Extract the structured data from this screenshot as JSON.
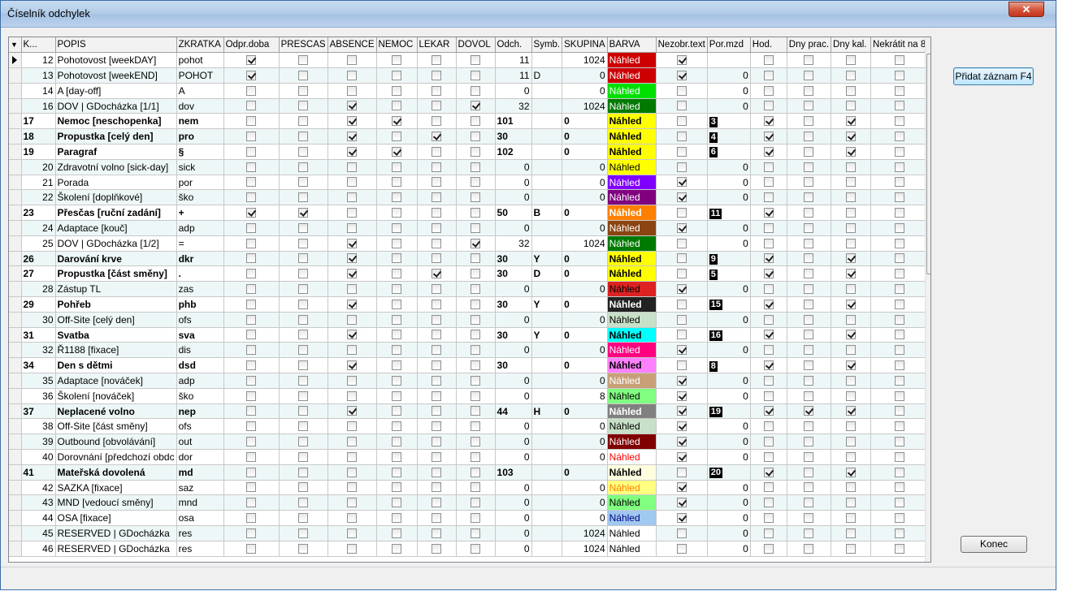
{
  "window": {
    "title": "Číselník odchylek",
    "close_symbol": "✕"
  },
  "buttons": {
    "add": "Přidat záznam F4",
    "close": "Konec"
  },
  "colors": {
    "titlebar": "#b4cde8",
    "row_even": "#eef7f7",
    "row_odd": "#ffffff",
    "close_button": "#c2331c"
  },
  "columns": [
    "K...",
    "POPIS",
    "ZKRATKA",
    "Odpr.doba",
    "PRESCAS",
    "ABSENCE",
    "NEMOC",
    "LEKAR",
    "DOVOL",
    "Odch.",
    "Symb.",
    "SKUPINA",
    "BARVA",
    "Nezobr.text",
    "Por.mzd",
    "Hod.",
    "Dny prac.",
    "Dny kal.",
    "Nekrátit na 8"
  ],
  "rows": [
    {
      "k": "12",
      "popis": "Pohotovost [weekDAY]",
      "zkratka": "pohot",
      "odpr": 1,
      "prescas": 0,
      "absence": 0,
      "nemoc": 0,
      "lekar": 0,
      "dovol": 0,
      "odch": "11",
      "symb": "",
      "skupina": "1024",
      "barva_text": "Náhled",
      "barva_bg": "#cc0000",
      "barva_fg": "#ffffff",
      "nezobr": 1,
      "pormzd": "",
      "hod": 0,
      "dnyprac": 0,
      "dnykal": 0,
      "nekratit": 0,
      "bold": false
    },
    {
      "k": "13",
      "popis": "Pohotovost [weekEND]",
      "zkratka": "POHOT",
      "odpr": 1,
      "prescas": 0,
      "absence": 0,
      "nemoc": 0,
      "lekar": 0,
      "dovol": 0,
      "odch": "11",
      "symb": "D",
      "skupina": "0",
      "barva_text": "Náhled",
      "barva_bg": "#cc0000",
      "barva_fg": "#ffffff",
      "nezobr": 1,
      "pormzd": "0",
      "hod": 0,
      "dnyprac": 0,
      "dnykal": 0,
      "nekratit": 0,
      "bold": false
    },
    {
      "k": "14",
      "popis": "A [day-off]",
      "zkratka": "A",
      "odpr": 0,
      "prescas": 0,
      "absence": 0,
      "nemoc": 0,
      "lekar": 0,
      "dovol": 0,
      "odch": "0",
      "symb": "",
      "skupina": "0",
      "barva_text": "Náhled",
      "barva_bg": "#00e000",
      "barva_fg": "#ffffff",
      "nezobr": 0,
      "pormzd": "0",
      "hod": 0,
      "dnyprac": 0,
      "dnykal": 0,
      "nekratit": 0,
      "bold": false
    },
    {
      "k": "16",
      "popis": "DOV | GDocházka [1/1]",
      "zkratka": "dov",
      "odpr": 0,
      "prescas": 0,
      "absence": 1,
      "nemoc": 0,
      "lekar": 0,
      "dovol": 1,
      "odch": "32",
      "symb": "",
      "skupina": "1024",
      "barva_text": "Náhled",
      "barva_bg": "#007a00",
      "barva_fg": "#ffffff",
      "nezobr": 0,
      "pormzd": "0",
      "hod": 0,
      "dnyprac": 0,
      "dnykal": 0,
      "nekratit": 0,
      "bold": false
    },
    {
      "k": "17",
      "popis": "Nemoc [neschopenka]",
      "zkratka": "nem",
      "odpr": 0,
      "prescas": 0,
      "absence": 1,
      "nemoc": 1,
      "lekar": 0,
      "dovol": 0,
      "odch": "101",
      "symb": "",
      "skupina": "0",
      "barva_text": "Náhled",
      "barva_bg": "#ffff00",
      "barva_fg": "#000000",
      "nezobr": 0,
      "pormzd": "3",
      "hod": 1,
      "dnyprac": 0,
      "dnykal": 1,
      "nekratit": 0,
      "bold": true
    },
    {
      "k": "18",
      "popis": "Propustka [celý den]",
      "zkratka": "pro",
      "odpr": 0,
      "prescas": 0,
      "absence": 1,
      "nemoc": 0,
      "lekar": 1,
      "dovol": 0,
      "odch": "30",
      "symb": "",
      "skupina": "0",
      "barva_text": "Náhled",
      "barva_bg": "#ffff00",
      "barva_fg": "#000000",
      "nezobr": 0,
      "pormzd": "4",
      "hod": 1,
      "dnyprac": 0,
      "dnykal": 1,
      "nekratit": 0,
      "bold": true
    },
    {
      "k": "19",
      "popis": "Paragraf",
      "zkratka": "§",
      "odpr": 0,
      "prescas": 0,
      "absence": 1,
      "nemoc": 1,
      "lekar": 0,
      "dovol": 0,
      "odch": "102",
      "symb": "",
      "skupina": "0",
      "barva_text": "Náhled",
      "barva_bg": "#ffff00",
      "barva_fg": "#000000",
      "nezobr": 0,
      "pormzd": "6",
      "hod": 1,
      "dnyprac": 0,
      "dnykal": 1,
      "nekratit": 0,
      "bold": true
    },
    {
      "k": "20",
      "popis": "Zdravotní volno [sick-day]",
      "zkratka": "sick",
      "odpr": 0,
      "prescas": 0,
      "absence": 0,
      "nemoc": 0,
      "lekar": 0,
      "dovol": 0,
      "odch": "0",
      "symb": "",
      "skupina": "0",
      "barva_text": "Náhled",
      "barva_bg": "#ffff00",
      "barva_fg": "#000000",
      "nezobr": 0,
      "pormzd": "0",
      "hod": 0,
      "dnyprac": 0,
      "dnykal": 0,
      "nekratit": 0,
      "bold": false
    },
    {
      "k": "21",
      "popis": "Porada",
      "zkratka": "por",
      "odpr": 0,
      "prescas": 0,
      "absence": 0,
      "nemoc": 0,
      "lekar": 0,
      "dovol": 0,
      "odch": "0",
      "symb": "",
      "skupina": "0",
      "barva_text": "Náhled",
      "barva_bg": "#8000ff",
      "barva_fg": "#ffffff",
      "nezobr": 1,
      "pormzd": "0",
      "hod": 0,
      "dnyprac": 0,
      "dnykal": 0,
      "nekratit": 0,
      "bold": false
    },
    {
      "k": "22",
      "popis": "Školení [doplňkové]",
      "zkratka": "ško",
      "odpr": 0,
      "prescas": 0,
      "absence": 0,
      "nemoc": 0,
      "lekar": 0,
      "dovol": 0,
      "odch": "0",
      "symb": "",
      "skupina": "0",
      "barva_text": "Náhled",
      "barva_bg": "#800080",
      "barva_fg": "#ffffff",
      "nezobr": 1,
      "pormzd": "0",
      "hod": 0,
      "dnyprac": 0,
      "dnykal": 0,
      "nekratit": 0,
      "bold": false
    },
    {
      "k": "23",
      "popis": "Přesčas [ruční zadání]",
      "zkratka": "+",
      "odpr": 1,
      "prescas": 1,
      "absence": 0,
      "nemoc": 0,
      "lekar": 0,
      "dovol": 0,
      "odch": "50",
      "symb": "B",
      "skupina": "0",
      "barva_text": "Náhled",
      "barva_bg": "#ff8000",
      "barva_fg": "#ffffff",
      "nezobr": 0,
      "pormzd": "11",
      "hod": 1,
      "dnyprac": 0,
      "dnykal": 0,
      "nekratit": 0,
      "bold": true
    },
    {
      "k": "24",
      "popis": "Adaptace [kouč]",
      "zkratka": "adp",
      "odpr": 0,
      "prescas": 0,
      "absence": 0,
      "nemoc": 0,
      "lekar": 0,
      "dovol": 0,
      "odch": "0",
      "symb": "",
      "skupina": "0",
      "barva_text": "Náhled",
      "barva_bg": "#8b4513",
      "barva_fg": "#ffffff",
      "nezobr": 1,
      "pormzd": "0",
      "hod": 0,
      "dnyprac": 0,
      "dnykal": 0,
      "nekratit": 0,
      "bold": false
    },
    {
      "k": "25",
      "popis": "DOV | GDocházka [1/2]",
      "zkratka": "=",
      "odpr": 0,
      "prescas": 0,
      "absence": 1,
      "nemoc": 0,
      "lekar": 0,
      "dovol": 1,
      "odch": "32",
      "symb": "",
      "skupina": "1024",
      "barva_text": "Náhled",
      "barva_bg": "#007a00",
      "barva_fg": "#ffffff",
      "nezobr": 0,
      "pormzd": "0",
      "hod": 0,
      "dnyprac": 0,
      "dnykal": 0,
      "nekratit": 0,
      "bold": false
    },
    {
      "k": "26",
      "popis": "Darování krve",
      "zkratka": "dkr",
      "odpr": 0,
      "prescas": 0,
      "absence": 1,
      "nemoc": 0,
      "lekar": 0,
      "dovol": 0,
      "odch": "30",
      "symb": "Y",
      "skupina": "0",
      "barva_text": "Náhled",
      "barva_bg": "#ffff00",
      "barva_fg": "#000000",
      "nezobr": 0,
      "pormzd": "9",
      "hod": 1,
      "dnyprac": 0,
      "dnykal": 1,
      "nekratit": 0,
      "bold": true
    },
    {
      "k": "27",
      "popis": "Propustka [část směny]",
      "zkratka": ".",
      "odpr": 0,
      "prescas": 0,
      "absence": 1,
      "nemoc": 0,
      "lekar": 1,
      "dovol": 0,
      "odch": "30",
      "symb": "D",
      "skupina": "0",
      "barva_text": "Náhled",
      "barva_bg": "#ffff00",
      "barva_fg": "#000000",
      "nezobr": 0,
      "pormzd": "5",
      "hod": 1,
      "dnyprac": 0,
      "dnykal": 1,
      "nekratit": 0,
      "bold": true
    },
    {
      "k": "28",
      "popis": "Zástup TL",
      "zkratka": "zas",
      "odpr": 0,
      "prescas": 0,
      "absence": 0,
      "nemoc": 0,
      "lekar": 0,
      "dovol": 0,
      "odch": "0",
      "symb": "",
      "skupina": "0",
      "barva_text": "Náhled",
      "barva_bg": "#dd2222",
      "barva_fg": "#000000",
      "nezobr": 1,
      "pormzd": "0",
      "hod": 0,
      "dnyprac": 0,
      "dnykal": 0,
      "nekratit": 0,
      "bold": false
    },
    {
      "k": "29",
      "popis": "Pohřeb",
      "zkratka": "phb",
      "odpr": 0,
      "prescas": 0,
      "absence": 1,
      "nemoc": 0,
      "lekar": 0,
      "dovol": 0,
      "odch": "30",
      "symb": "Y",
      "skupina": "0",
      "barva_text": "Náhled",
      "barva_bg": "#222222",
      "barva_fg": "#ffffff",
      "nezobr": 0,
      "pormzd": "15",
      "hod": 1,
      "dnyprac": 0,
      "dnykal": 1,
      "nekratit": 0,
      "bold": true
    },
    {
      "k": "30",
      "popis": "Off-Site [celý den]",
      "zkratka": "ofs",
      "odpr": 0,
      "prescas": 0,
      "absence": 0,
      "nemoc": 0,
      "lekar": 0,
      "dovol": 0,
      "odch": "0",
      "symb": "",
      "skupina": "0",
      "barva_text": "Náhled",
      "barva_bg": "#c8e0c8",
      "barva_fg": "#000000",
      "nezobr": 0,
      "pormzd": "0",
      "hod": 0,
      "dnyprac": 0,
      "dnykal": 0,
      "nekratit": 0,
      "bold": false
    },
    {
      "k": "31",
      "popis": "Svatba",
      "zkratka": "sva",
      "odpr": 0,
      "prescas": 0,
      "absence": 1,
      "nemoc": 0,
      "lekar": 0,
      "dovol": 0,
      "odch": "30",
      "symb": "Y",
      "skupina": "0",
      "barva_text": "Náhled",
      "barva_bg": "#00ffff",
      "barva_fg": "#000000",
      "nezobr": 0,
      "pormzd": "16",
      "hod": 1,
      "dnyprac": 0,
      "dnykal": 1,
      "nekratit": 0,
      "bold": true
    },
    {
      "k": "32",
      "popis": "Ř1188 [fixace]",
      "zkratka": "dis",
      "odpr": 0,
      "prescas": 0,
      "absence": 0,
      "nemoc": 0,
      "lekar": 0,
      "dovol": 0,
      "odch": "0",
      "symb": "",
      "skupina": "0",
      "barva_text": "Náhled",
      "barva_bg": "#ff0080",
      "barva_fg": "#ffffff",
      "nezobr": 1,
      "pormzd": "0",
      "hod": 0,
      "dnyprac": 0,
      "dnykal": 0,
      "nekratit": 0,
      "bold": false
    },
    {
      "k": "34",
      "popis": "Den s dětmi",
      "zkratka": "dsd",
      "odpr": 0,
      "prescas": 0,
      "absence": 1,
      "nemoc": 0,
      "lekar": 0,
      "dovol": 0,
      "odch": "30",
      "symb": "",
      "skupina": "0",
      "barva_text": "Náhled",
      "barva_bg": "#ff80ff",
      "barva_fg": "#000000",
      "nezobr": 0,
      "pormzd": "8",
      "hod": 1,
      "dnyprac": 0,
      "dnykal": 1,
      "nekratit": 0,
      "bold": true
    },
    {
      "k": "35",
      "popis": "Adaptace [nováček]",
      "zkratka": "adp",
      "odpr": 0,
      "prescas": 0,
      "absence": 0,
      "nemoc": 0,
      "lekar": 0,
      "dovol": 0,
      "odch": "0",
      "symb": "",
      "skupina": "0",
      "barva_text": "Náhled",
      "barva_bg": "#c8a078",
      "barva_fg": "#ffffff",
      "nezobr": 1,
      "pormzd": "0",
      "hod": 0,
      "dnyprac": 0,
      "dnykal": 0,
      "nekratit": 0,
      "bold": false
    },
    {
      "k": "36",
      "popis": "Školení [nováček]",
      "zkratka": "ško",
      "odpr": 0,
      "prescas": 0,
      "absence": 0,
      "nemoc": 0,
      "lekar": 0,
      "dovol": 0,
      "odch": "0",
      "symb": "",
      "skupina": "8",
      "barva_text": "Náhled",
      "barva_bg": "#80ff80",
      "barva_fg": "#000000",
      "nezobr": 1,
      "pormzd": "0",
      "hod": 0,
      "dnyprac": 0,
      "dnykal": 0,
      "nekratit": 0,
      "bold": false
    },
    {
      "k": "37",
      "popis": "Neplacené volno",
      "zkratka": "nep",
      "odpr": 0,
      "prescas": 0,
      "absence": 1,
      "nemoc": 0,
      "lekar": 0,
      "dovol": 0,
      "odch": "44",
      "symb": "H",
      "skupina": "0",
      "barva_text": "Náhled",
      "barva_bg": "#808080",
      "barva_fg": "#ffffff",
      "nezobr": 1,
      "pormzd": "19",
      "hod": 1,
      "dnyprac": 1,
      "dnykal": 1,
      "nekratit": 0,
      "bold": true
    },
    {
      "k": "38",
      "popis": "Off-Site [část směny]",
      "zkratka": "ofs",
      "odpr": 0,
      "prescas": 0,
      "absence": 0,
      "nemoc": 0,
      "lekar": 0,
      "dovol": 0,
      "odch": "0",
      "symb": "",
      "skupina": "0",
      "barva_text": "Náhled",
      "barva_bg": "#c8e0c8",
      "barva_fg": "#000000",
      "nezobr": 1,
      "pormzd": "0",
      "hod": 0,
      "dnyprac": 0,
      "dnykal": 0,
      "nekratit": 0,
      "bold": false
    },
    {
      "k": "39",
      "popis": "Outbound [obvolávání]",
      "zkratka": "out",
      "odpr": 0,
      "prescas": 0,
      "absence": 0,
      "nemoc": 0,
      "lekar": 0,
      "dovol": 0,
      "odch": "0",
      "symb": "",
      "skupina": "0",
      "barva_text": "Náhled",
      "barva_bg": "#800000",
      "barva_fg": "#ffffff",
      "nezobr": 1,
      "pormzd": "0",
      "hod": 0,
      "dnyprac": 0,
      "dnykal": 0,
      "nekratit": 0,
      "bold": false
    },
    {
      "k": "40",
      "popis": "Dorovnání [předchozí obdc",
      "zkratka": "dor",
      "odpr": 0,
      "prescas": 0,
      "absence": 0,
      "nemoc": 0,
      "lekar": 0,
      "dovol": 0,
      "odch": "0",
      "symb": "",
      "skupina": "0",
      "barva_text": "Náhled",
      "barva_bg": "#ffffff",
      "barva_fg": "#ff0000",
      "nezobr": 1,
      "pormzd": "0",
      "hod": 0,
      "dnyprac": 0,
      "dnykal": 0,
      "nekratit": 0,
      "bold": false
    },
    {
      "k": "41",
      "popis": "Mateřská dovolená",
      "zkratka": "md",
      "odpr": 0,
      "prescas": 0,
      "absence": 0,
      "nemoc": 0,
      "lekar": 0,
      "dovol": 0,
      "odch": "103",
      "symb": "",
      "skupina": "0",
      "barva_text": "Náhled",
      "barva_bg": "#ffffe0",
      "barva_fg": "#000000",
      "nezobr": 0,
      "pormzd": "20",
      "hod": 1,
      "dnyprac": 0,
      "dnykal": 1,
      "nekratit": 0,
      "bold": true
    },
    {
      "k": "42",
      "popis": "SAZKA [fixace]",
      "zkratka": "saz",
      "odpr": 0,
      "prescas": 0,
      "absence": 0,
      "nemoc": 0,
      "lekar": 0,
      "dovol": 0,
      "odch": "0",
      "symb": "",
      "skupina": "0",
      "barva_text": "Náhled",
      "barva_bg": "#ffff80",
      "barva_fg": "#ff8000",
      "nezobr": 1,
      "pormzd": "0",
      "hod": 0,
      "dnyprac": 0,
      "dnykal": 0,
      "nekratit": 0,
      "bold": false
    },
    {
      "k": "43",
      "popis": "MND [vedoucí směny]",
      "zkratka": "mnd",
      "odpr": 0,
      "prescas": 0,
      "absence": 0,
      "nemoc": 0,
      "lekar": 0,
      "dovol": 0,
      "odch": "0",
      "symb": "",
      "skupina": "0",
      "barva_text": "Náhled",
      "barva_bg": "#80ff80",
      "barva_fg": "#000000",
      "nezobr": 1,
      "pormzd": "0",
      "hod": 0,
      "dnyprac": 0,
      "dnykal": 0,
      "nekratit": 0,
      "bold": false
    },
    {
      "k": "44",
      "popis": "OSA [fixace]",
      "zkratka": "osa",
      "odpr": 0,
      "prescas": 0,
      "absence": 0,
      "nemoc": 0,
      "lekar": 0,
      "dovol": 0,
      "odch": "0",
      "symb": "",
      "skupina": "0",
      "barva_text": "Náhled",
      "barva_bg": "#a0c8f0",
      "barva_fg": "#000080",
      "nezobr": 1,
      "pormzd": "0",
      "hod": 0,
      "dnyprac": 0,
      "dnykal": 0,
      "nekratit": 0,
      "bold": false
    },
    {
      "k": "45",
      "popis": "RESERVED | GDocházka",
      "zkratka": "res",
      "odpr": 0,
      "prescas": 0,
      "absence": 0,
      "nemoc": 0,
      "lekar": 0,
      "dovol": 0,
      "odch": "0",
      "symb": "",
      "skupina": "1024",
      "barva_text": "Náhled",
      "barva_bg": "#ffffff",
      "barva_fg": "#000000",
      "nezobr": 0,
      "pormzd": "0",
      "hod": 0,
      "dnyprac": 0,
      "dnykal": 0,
      "nekratit": 0,
      "bold": false
    },
    {
      "k": "46",
      "popis": "RESERVED | GDocházka",
      "zkratka": "res",
      "odpr": 0,
      "prescas": 0,
      "absence": 0,
      "nemoc": 0,
      "lekar": 0,
      "dovol": 0,
      "odch": "0",
      "symb": "",
      "skupina": "1024",
      "barva_text": "Náhled",
      "barva_bg": "#ffffff",
      "barva_fg": "#000000",
      "nezobr": 0,
      "pormzd": "0",
      "hod": 0,
      "dnyprac": 0,
      "dnykal": 0,
      "nekratit": 0,
      "bold": false
    }
  ]
}
